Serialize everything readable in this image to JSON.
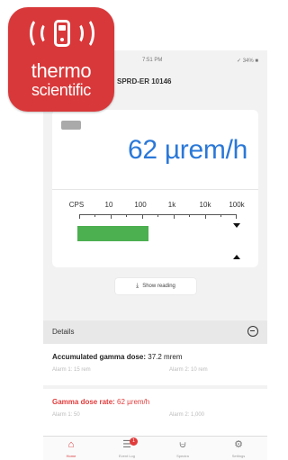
{
  "logo": {
    "line1": "thermo",
    "line2": "scientific",
    "color": "#d9383a"
  },
  "status_bar": {
    "time": "7:51 PM",
    "battery": "✓ 34% ■"
  },
  "nav": {
    "title": "SPRD-ER 10146"
  },
  "reading": {
    "value": "62 µrem/h",
    "color": "#2a78d8"
  },
  "scale": {
    "labels": [
      "CPS",
      "10",
      "100",
      "1k",
      "10k",
      "100k"
    ],
    "bar_fraction": 0.45,
    "bar_color": "#4caf50"
  },
  "show_button": {
    "label": "Show reading",
    "icon": "download-icon"
  },
  "details": {
    "title": "Details",
    "accumulated": {
      "label": "Accumulated gamma dose:",
      "value": "37.2 mrem",
      "alarm1": "Alarm 1: 15 rem",
      "alarm2": "Alarm 2: 10 rem"
    },
    "rate": {
      "label": "Gamma dose rate:",
      "value": "62 µrem/h",
      "alarm1": "Alarm 1: 50",
      "alarm2": "Alarm 2: 1,000",
      "color": "#e23b3b"
    }
  },
  "tabs": [
    {
      "label": "Home",
      "icon": "home-icon",
      "active": true
    },
    {
      "label": "Event Log",
      "icon": "list-icon",
      "badge": "1"
    },
    {
      "label": "Spectra",
      "icon": "chart-icon"
    },
    {
      "label": "Settings",
      "icon": "gear-icon"
    }
  ]
}
